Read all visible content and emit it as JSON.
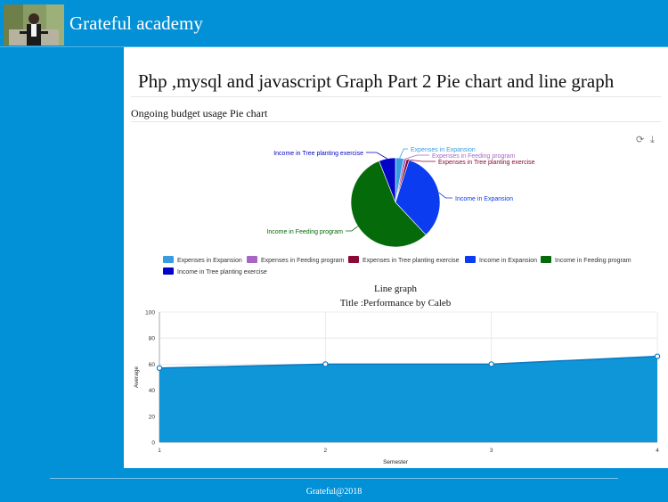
{
  "header": {
    "brand": "Grateful academy"
  },
  "page": {
    "title": "Php ,mysql and javascript Graph Part 2 Pie chart and line graph",
    "section_label": "Ongoing budget usage Pie chart"
  },
  "toolbar": {
    "refresh_icon": "refresh-icon",
    "download_icon": "download-icon"
  },
  "chart_data": [
    {
      "type": "pie",
      "slices": [
        {
          "label": "Expenses in Expansion",
          "value": 3,
          "color": "#3a9ce0"
        },
        {
          "label": "Expenses in Feeding program",
          "value": 1,
          "color": "#a866c4"
        },
        {
          "label": "Expenses in Tree planting exercise",
          "value": 1,
          "color": "#8b0a35"
        },
        {
          "label": "Income in Expansion",
          "value": 33,
          "color": "#0b3cf0"
        },
        {
          "label": "Income in Feeding program",
          "value": 56,
          "color": "#046a0a"
        },
        {
          "label": "Income in Tree planting exercise",
          "value": 6,
          "color": "#0404c8"
        }
      ],
      "legend_position": "bottom"
    },
    {
      "type": "area",
      "title": "Line graph",
      "subtitle": "Title :Performance by Caleb",
      "xlabel": "Semester",
      "ylabel": "Average",
      "x": [
        1,
        2,
        3,
        4
      ],
      "values": [
        57,
        60,
        60,
        66
      ],
      "ylim": [
        0,
        100
      ],
      "yticks": [
        0,
        20,
        40,
        60,
        80,
        100
      ],
      "grid": true,
      "color": "#0290d6"
    }
  ],
  "footer": {
    "text": "Grateful@2018"
  }
}
